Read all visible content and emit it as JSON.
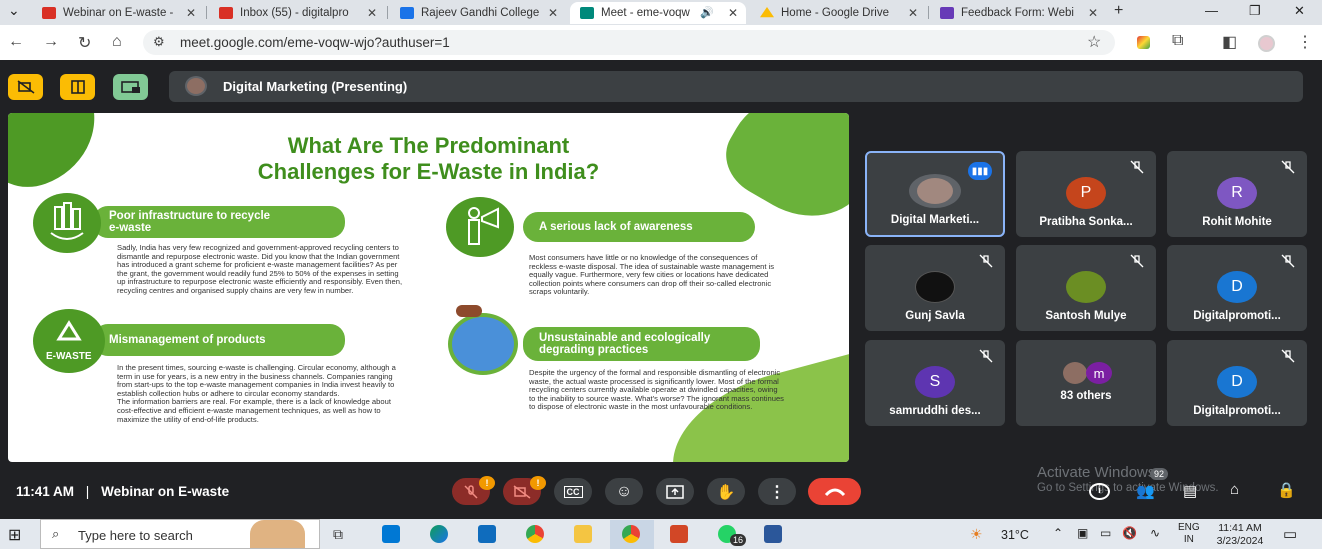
{
  "tabs": [
    {
      "title": "Webinar on E-waste -",
      "color": "#d93025"
    },
    {
      "title": "Inbox (55) - digitalpro",
      "color": "#d93025"
    },
    {
      "title": "Rajeev Gandhi College",
      "color": "#1a73e8"
    },
    {
      "title": "Meet - eme-voqw",
      "color": "#00897b"
    },
    {
      "title": "Home - Google Drive",
      "color": "#fbbc04"
    },
    {
      "title": "Feedback Form: Webi",
      "color": "#673ab7"
    }
  ],
  "address": {
    "url": "meet.google.com/eme-voqw-wjo?authuser=1"
  },
  "presenter": {
    "label": "Digital Marketing (Presenting)"
  },
  "slide": {
    "title_line1": "What Are The Predominant",
    "title_line2": "Challenges for E-Waste in India?",
    "s1_heading": "Poor infrastructure to recycle e-waste",
    "s1_body": "Sadly, India has very few recognized and government-approved recycling centers to dismantle and repurpose electronic waste. Did you know that the Indian government has introduced a grant scheme for proficient e-waste management facilities? As per the grant, the government would readily fund 25% to 50% of the expenses in setting up infrastructure to repurpose electronic waste efficiently and responsibly. Even then, recycling centres and organised supply chains are very few in number.",
    "s2_heading": "A serious lack of awareness",
    "s2_body": "Most consumers have little or no knowledge of the consequences of reckless e-waste disposal. The idea of sustainable waste management is equally vague. Furthermore, very few cities or locations have dedicated collection points where consumers can drop off their so-called electronic scraps voluntarily.",
    "s3_heading": "Mismanagement of products",
    "s3_badge": "E-WASTE",
    "s3_body": "In the present times, sourcing e-waste is challenging. Circular economy, although a term in use for years, is a new entry in the business channels. Companies ranging from start-ups to the top e-waste management companies in India invest heavily to establish collection hubs or adhere to circular economy standards.\nThe information barriers are real. For example, there is a lack of knowledge about cost-effective and efficient e-waste management techniques, as well as how to maximize the utility of end-of-life products.",
    "s4_heading": "Unsustainable and ecologically degrading practices",
    "s4_body": "Despite the urgency of the formal and responsible dismantling of electronic waste, the actual waste processed is significantly lower. Most of the formal recycling centers currently available operate at dwindled capacities, owing to the inability to source waste. What's worse? The ignorant mass continues to dispose of electronic waste in the most unfavourable conditions."
  },
  "participants": [
    {
      "name": "Digital Marketi...",
      "initial": "",
      "color": "#5f6368"
    },
    {
      "name": "Pratibha Sonka...",
      "initial": "P",
      "color": "#c5451c"
    },
    {
      "name": "Rohit Mohite",
      "initial": "R",
      "color": "#7e57c2"
    },
    {
      "name": "Gunj Savla",
      "initial": "",
      "color": "#222"
    },
    {
      "name": "Santosh Mulye",
      "initial": "",
      "color": "#6b8e23"
    },
    {
      "name": "Digitalpromoti...",
      "initial": "D",
      "color": "#1976d2"
    },
    {
      "name": "samruddhi des...",
      "initial": "S",
      "color": "#5e35b1"
    },
    {
      "name": "83 others",
      "initial": "m",
      "color": "#7b1fa2"
    },
    {
      "name": "Digitalpromoti...",
      "initial": "D",
      "color": "#1976d2"
    }
  ],
  "meeting": {
    "time": "11:41 AM",
    "separator": "|",
    "name": "Webinar on E-waste",
    "people_count": "92",
    "warn_mark": "!"
  },
  "activation": {
    "line1": "Activate Windows",
    "line2": "Go to Settings to activate Windows."
  },
  "taskbar": {
    "search_placeholder": "Type here to search",
    "temperature": "31°C",
    "lang1": "ENG",
    "lang2": "IN",
    "time": "11:41 AM",
    "date": "3/23/2024",
    "whatsapp_badge": "16"
  }
}
